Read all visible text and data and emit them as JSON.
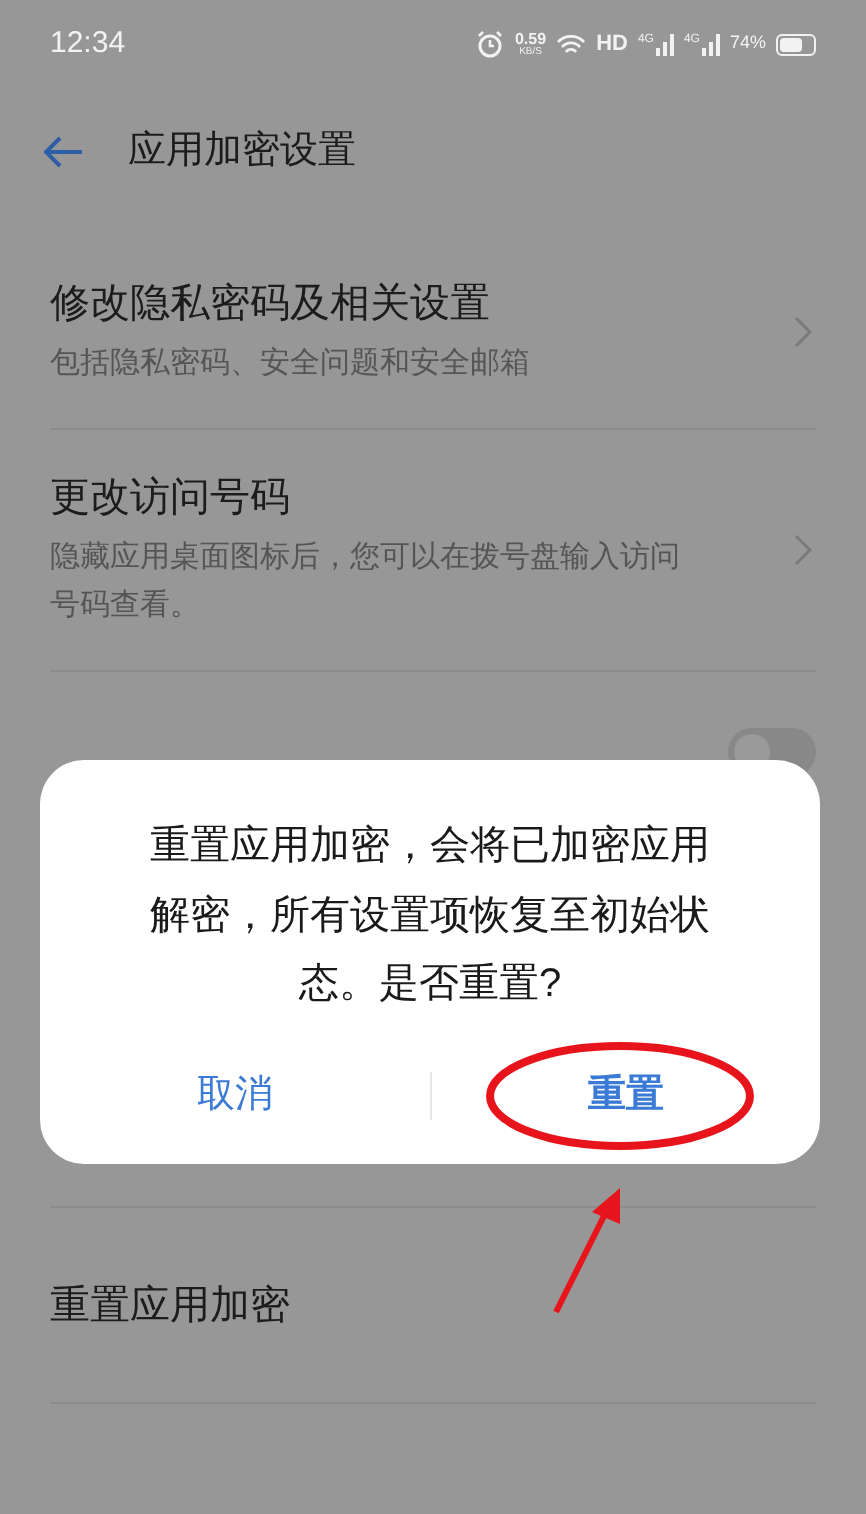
{
  "status_bar": {
    "time": "12:34",
    "speed": "0.59",
    "speed_unit": "KB/S",
    "hd": "HD",
    "networks": [
      "4G",
      "4G"
    ],
    "battery": "74%"
  },
  "header": {
    "title": "应用加密设置"
  },
  "settings": [
    {
      "kind": "link",
      "title": "修改隐私密码及相关设置",
      "subtitle": "包括隐私密码、安全问题和安全邮箱"
    },
    {
      "kind": "link",
      "title": "更改访问号码",
      "subtitle": "隐藏应用桌面图标后，您可以在拨号盘输入访问号码查看。"
    },
    {
      "kind": "toggle",
      "on": false
    },
    {
      "kind": "plain",
      "title": "重置应用加密"
    }
  ],
  "dialog": {
    "message": "重置应用加密，会将已加密应用解密，所有设置项恢复至初始状态。是否重置?",
    "buttons": [
      {
        "label": "取消",
        "highlighted": false
      },
      {
        "label": "重置",
        "highlighted": true
      }
    ]
  }
}
